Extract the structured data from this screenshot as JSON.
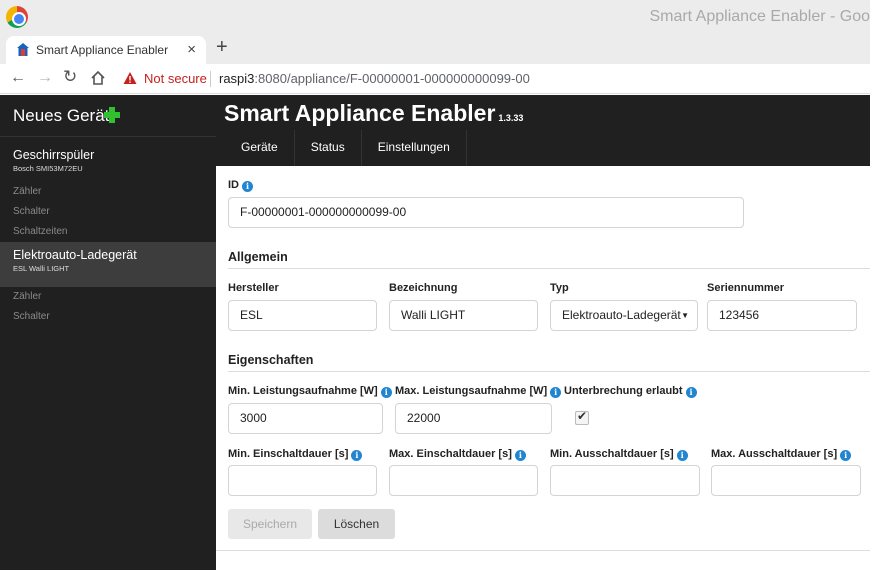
{
  "browser": {
    "window_title": "Smart Appliance Enabler - Goo",
    "tab_title": "Smart Appliance Enabler",
    "new_tab_label": "+",
    "close_label": "×",
    "security_label": "Not secure",
    "url_host": "raspi3",
    "url_rest": ":8080/appliance/F-00000001-000000000099-00"
  },
  "sidebar": {
    "new_device_label": "Neues Gerät",
    "devices": [
      {
        "name": "Geschirrspüler",
        "sub": "Bosch SMI53M72EU",
        "links": [
          "Zähler",
          "Schalter",
          "Schaltzeiten"
        ]
      },
      {
        "name": "Elektroauto-Ladegerät",
        "sub": "ESL Walli LIGHT",
        "links": [
          "Zähler",
          "Schalter"
        ]
      }
    ]
  },
  "header": {
    "title": "Smart Appliance Enabler",
    "version": "1.3.33",
    "menu": [
      "Geräte",
      "Status",
      "Einstellungen"
    ]
  },
  "form": {
    "id_label": "ID",
    "id_value": "F-00000001-000000000099-00",
    "section_general": "Allgemein",
    "manufacturer_label": "Hersteller",
    "manufacturer_value": "ESL",
    "name_label": "Bezeichnung",
    "name_value": "Walli LIGHT",
    "type_label": "Typ",
    "type_value": "Elektroauto-Ladegerät",
    "serial_label": "Seriennummer",
    "serial_value": "123456",
    "section_properties": "Eigenschaften",
    "min_power_label": "Min. Leistungsaufnahme [W]",
    "min_power_value": "3000",
    "max_power_label": "Max. Leistungsaufnahme [W]",
    "max_power_value": "22000",
    "interruption_label": "Unterbrechung erlaubt",
    "interruption_checked": true,
    "min_on_label": "Min. Einschaltdauer [s]",
    "min_on_value": "",
    "max_on_label": "Max. Einschaltdauer [s]",
    "max_on_value": "",
    "min_off_label": "Min. Ausschaltdauer [s]",
    "min_off_value": "",
    "max_off_label": "Max. Ausschaltdauer [s]",
    "max_off_value": "",
    "save_label": "Speichern",
    "delete_label": "Löschen",
    "info_glyph": "i"
  }
}
